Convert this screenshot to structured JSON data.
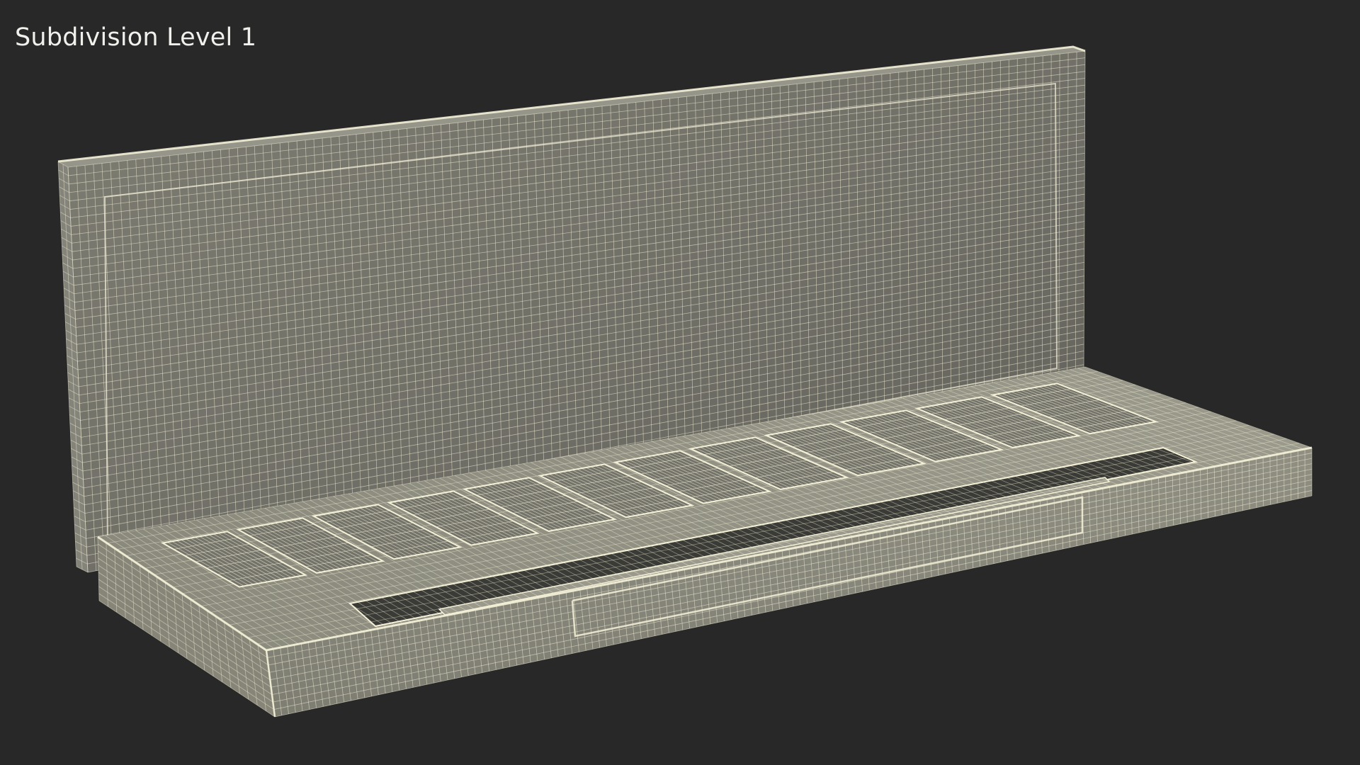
{
  "viewport": {
    "caption": "Subdivision Level 1",
    "background_color": "#282828"
  },
  "render": {
    "subject": "eyeshadow palette wireframe",
    "shade_count": 12,
    "colors": {
      "surface_light": "#8c8b7c",
      "surface_mid": "#74736a",
      "surface_dark": "#5c5b54",
      "wire": "#f4f1d8",
      "cavity": "#3a3a36"
    }
  }
}
